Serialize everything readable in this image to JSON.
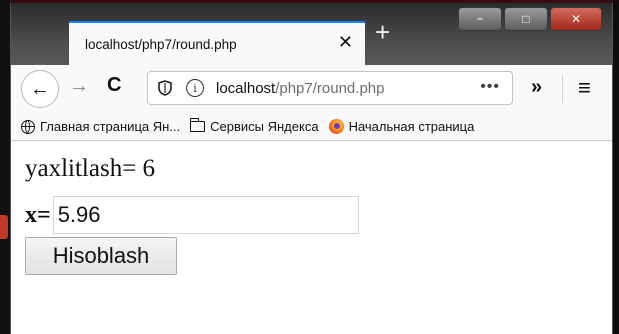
{
  "window": {
    "controls": {
      "minimize": "−",
      "maximize": "□",
      "close": "✕"
    }
  },
  "tab": {
    "title": "localhost/php7/round.php",
    "close_glyph": "✕",
    "new_tab_glyph": "+"
  },
  "nav": {
    "back_glyph": "←",
    "forward_glyph": "→",
    "reload_glyph": "C",
    "url_host": "localhost",
    "url_path": "/php7/round.php",
    "more_glyph": "•••",
    "overflow_glyph": "»",
    "menu_glyph": "≡",
    "icons": [
      "shield-icon",
      "info-icon"
    ]
  },
  "bookmarks": [
    {
      "label": "Главная страница Ян...",
      "icon": "globe-icon"
    },
    {
      "label": "Сервисы Яндекса",
      "icon": "folder-icon"
    },
    {
      "label": "Начальная страница",
      "icon": "firefox-icon"
    }
  ],
  "page": {
    "result_text": "yaxlitlash= 6",
    "x_label": "x=",
    "x_value": "5.96",
    "submit_label": "Hisoblash"
  },
  "colors": {
    "tab_accent": "#0a84ff",
    "close_button": "#c0392b"
  }
}
